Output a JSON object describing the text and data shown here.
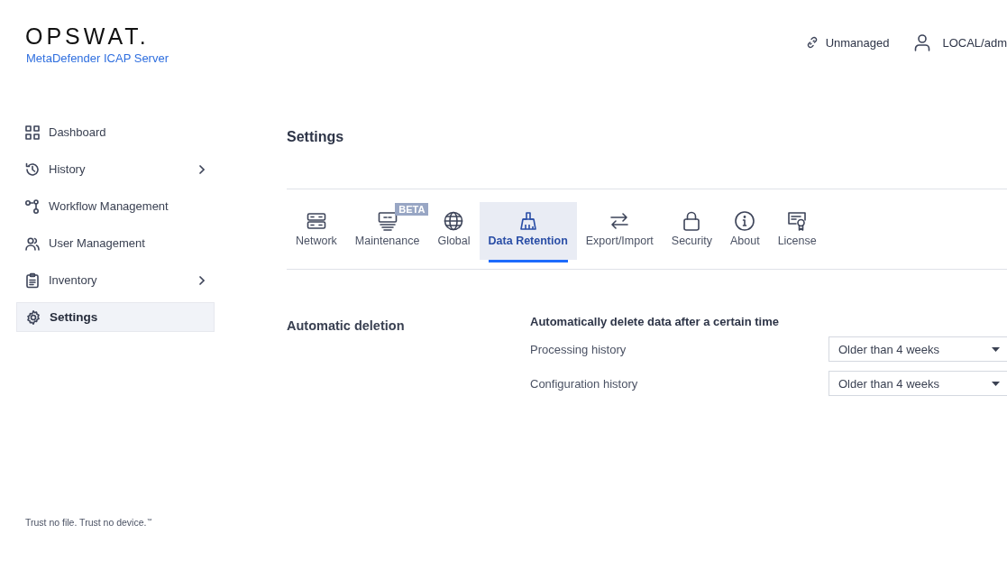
{
  "brand": {
    "logo": "OPSWAT.",
    "product": "MetaDefender ICAP Server"
  },
  "header": {
    "status": "Unmanaged",
    "user": "LOCAL/adm"
  },
  "sidebar": {
    "items": [
      {
        "label": "Dashboard",
        "selected": false,
        "expandable": false
      },
      {
        "label": "History",
        "selected": false,
        "expandable": true
      },
      {
        "label": "Workflow Management",
        "selected": false,
        "expandable": false
      },
      {
        "label": "User Management",
        "selected": false,
        "expandable": false
      },
      {
        "label": "Inventory",
        "selected": false,
        "expandable": true
      },
      {
        "label": "Settings",
        "selected": true,
        "expandable": false
      }
    ],
    "tagline": "Trust no file. Trust no device.$^{™}$"
  },
  "page_title": "Settings",
  "tabs": [
    {
      "label": "Network",
      "selected": false
    },
    {
      "label": "Maintenance",
      "selected": false,
      "badge": "BETA"
    },
    {
      "label": "Global",
      "selected": false
    },
    {
      "label": "Data Retention",
      "selected": true
    },
    {
      "label": "Export/Import",
      "selected": false
    },
    {
      "label": "Security",
      "selected": false
    },
    {
      "label": "About",
      "selected": false
    },
    {
      "label": "License",
      "selected": false
    }
  ],
  "section": {
    "title": "Automatic deletion",
    "description": "Automatically delete data after a certain time",
    "fields": [
      {
        "label": "Processing history",
        "value": "Older than 4 weeks"
      },
      {
        "label": "Configuration history",
        "value": "Older than 4 weeks"
      }
    ]
  }
}
